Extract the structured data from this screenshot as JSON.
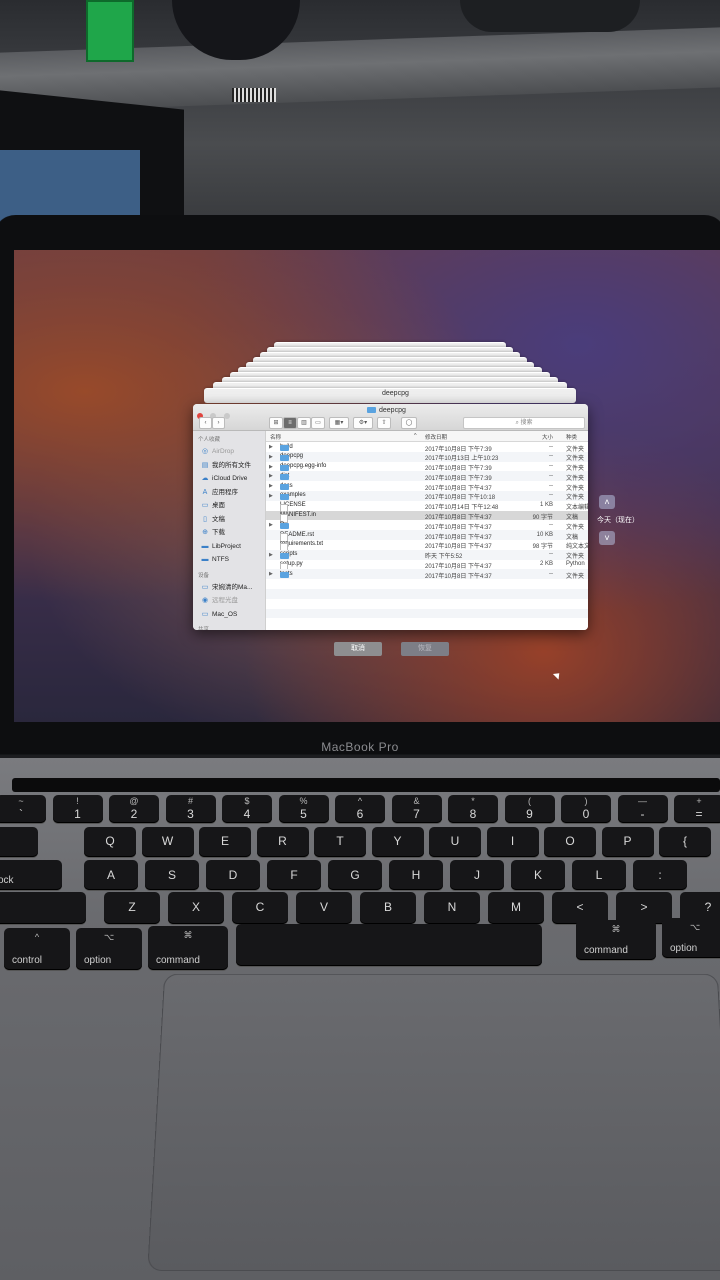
{
  "window": {
    "title": "deepcpg",
    "back_title": "deepcpg"
  },
  "toolbar": {
    "search_placeholder": "搜索"
  },
  "sidebar": {
    "favorites_header": "个人收藏",
    "favorites": [
      {
        "label": "AirDrop",
        "icon": "airdrop-icon",
        "glyph": "◎",
        "dim": true
      },
      {
        "label": "我的所有文件",
        "icon": "all-files-icon",
        "glyph": "▤",
        "dim": false
      },
      {
        "label": "iCloud Drive",
        "icon": "cloud-icon",
        "glyph": "☁",
        "dim": false
      },
      {
        "label": "应用程序",
        "icon": "applications-icon",
        "glyph": "A",
        "dim": false
      },
      {
        "label": "桌面",
        "icon": "desktop-icon",
        "glyph": "▭",
        "dim": false
      },
      {
        "label": "文稿",
        "icon": "documents-icon",
        "glyph": "▯",
        "dim": false
      },
      {
        "label": "下载",
        "icon": "downloads-icon",
        "glyph": "⊕",
        "dim": false
      },
      {
        "label": "LibProject",
        "icon": "folder-icon",
        "glyph": "▬",
        "dim": false
      },
      {
        "label": "NTFS",
        "icon": "folder-icon",
        "glyph": "▬",
        "dim": false
      }
    ],
    "devices_header": "设备",
    "devices": [
      {
        "label": "宋婉清的Ma...",
        "icon": "computer-icon",
        "glyph": "▭",
        "dim": false
      },
      {
        "label": "远程光盘",
        "icon": "remote-disc-icon",
        "glyph": "◉",
        "dim": true
      },
      {
        "label": "Mac_OS",
        "icon": "disk-icon",
        "glyph": "▭",
        "dim": false
      }
    ],
    "more_header": "共享"
  },
  "columns": {
    "name": "名称",
    "modified": "修改日期",
    "size": "大小",
    "kind": "种类"
  },
  "files": [
    {
      "name": "build",
      "folder": true,
      "date": "2017年10月8日 下午7:39",
      "size": "--",
      "kind": "文件夹"
    },
    {
      "name": "deepcpg",
      "folder": true,
      "date": "2017年10月13日 上午10:23",
      "size": "--",
      "kind": "文件夹"
    },
    {
      "name": "deepcpg.egg-info",
      "folder": true,
      "date": "2017年10月8日 下午7:39",
      "size": "--",
      "kind": "文件夹"
    },
    {
      "name": "dist",
      "folder": true,
      "date": "2017年10月8日 下午7:39",
      "size": "--",
      "kind": "文件夹"
    },
    {
      "name": "docs",
      "folder": true,
      "date": "2017年10月8日 下午4:37",
      "size": "--",
      "kind": "文件夹"
    },
    {
      "name": "examples",
      "folder": true,
      "date": "2017年10月8日 下午10:18",
      "size": "--",
      "kind": "文件夹"
    },
    {
      "name": "LICENSE",
      "folder": false,
      "date": "2017年10月14日 下午12:48",
      "size": "1 KB",
      "kind": "文本编辑"
    },
    {
      "name": "MANIFEST.in",
      "folder": false,
      "date": "2017年10月8日 下午4:37",
      "size": "90 字节",
      "kind": "文稿",
      "selected": true
    },
    {
      "name": "R",
      "folder": true,
      "date": "2017年10月8日 下午4:37",
      "size": "--",
      "kind": "文件夹"
    },
    {
      "name": "README.rst",
      "folder": false,
      "date": "2017年10月8日 下午4:37",
      "size": "10 KB",
      "kind": "文稿"
    },
    {
      "name": "requirements.txt",
      "folder": false,
      "date": "2017年10月8日 下午4:37",
      "size": "98 字节",
      "kind": "纯文本文"
    },
    {
      "name": "scripts",
      "folder": true,
      "date": "昨天 下午5:52",
      "size": "--",
      "kind": "文件夹"
    },
    {
      "name": "setup.py",
      "folder": false,
      "date": "2017年10月8日 下午4:37",
      "size": "2 KB",
      "kind": "Python"
    },
    {
      "name": "tests",
      "folder": true,
      "date": "2017年10月8日 下午4:37",
      "size": "--",
      "kind": "文件夹"
    }
  ],
  "buttons": {
    "cancel": "取消",
    "restore": "恢复"
  },
  "timeline": {
    "label": "今天（现在）"
  },
  "brand": "MacBook Pro",
  "keyboard": {
    "number_row": [
      {
        "top": "~",
        "bottom": "`"
      },
      {
        "top": "!",
        "bottom": "1"
      },
      {
        "top": "@",
        "bottom": "2"
      },
      {
        "top": "#",
        "bottom": "3"
      },
      {
        "top": "$",
        "bottom": "4"
      },
      {
        "top": "%",
        "bottom": "5"
      },
      {
        "top": "^",
        "bottom": "6"
      },
      {
        "top": "&",
        "bottom": "7"
      },
      {
        "top": "*",
        "bottom": "8"
      },
      {
        "top": "(",
        "bottom": "9"
      },
      {
        "top": ")",
        "bottom": "0"
      },
      {
        "top": "—",
        "bottom": "-"
      },
      {
        "top": "+",
        "bottom": "="
      }
    ],
    "row_q": [
      "Q",
      "W",
      "E",
      "R",
      "T",
      "Y",
      "U",
      "I",
      "O",
      "P",
      "{"
    ],
    "row_a": [
      "A",
      "S",
      "D",
      "F",
      "G",
      "H",
      "J",
      "K",
      "L",
      ":"
    ],
    "row_z": [
      "Z",
      "X",
      "C",
      "V",
      "B",
      "N",
      "M",
      "<",
      ">",
      "?"
    ],
    "tab_label": "ab",
    "caps_label": "s lock",
    "control": "control",
    "option": "option",
    "command": "command",
    "option_glyph": "⌥",
    "command_glyph": "⌘",
    "control_glyph": "^"
  }
}
